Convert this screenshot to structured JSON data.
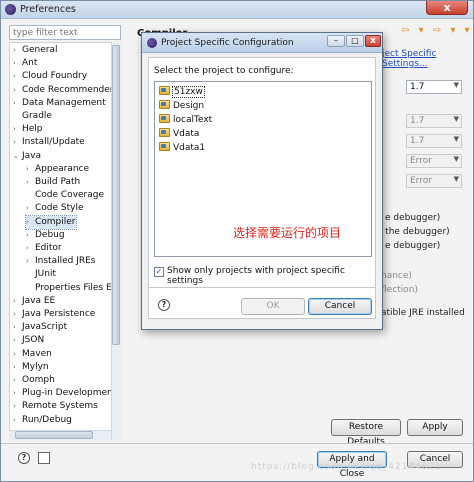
{
  "window": {
    "title": "Preferences",
    "close_glyph": "x"
  },
  "filter": {
    "placeholder": "type filter text"
  },
  "tree": {
    "items": [
      {
        "label": "General",
        "depth": 0,
        "expander": "›"
      },
      {
        "label": "Ant",
        "depth": 0,
        "expander": "›"
      },
      {
        "label": "Cloud Foundry",
        "depth": 0,
        "expander": "›"
      },
      {
        "label": "Code Recommenders",
        "depth": 0,
        "expander": "›"
      },
      {
        "label": "Data Management",
        "depth": 0,
        "expander": "›"
      },
      {
        "label": "Gradle",
        "depth": 0,
        "expander": ""
      },
      {
        "label": "Help",
        "depth": 0,
        "expander": "›"
      },
      {
        "label": "Install/Update",
        "depth": 0,
        "expander": "›"
      },
      {
        "label": "Java",
        "depth": 0,
        "expander": "⌄"
      },
      {
        "label": "Appearance",
        "depth": 1,
        "expander": "›"
      },
      {
        "label": "Build Path",
        "depth": 1,
        "expander": "›"
      },
      {
        "label": "Code Coverage",
        "depth": 1,
        "expander": ""
      },
      {
        "label": "Code Style",
        "depth": 1,
        "expander": "›"
      },
      {
        "label": "Compiler",
        "depth": 1,
        "expander": "›",
        "selected": true
      },
      {
        "label": "Debug",
        "depth": 1,
        "expander": "›"
      },
      {
        "label": "Editor",
        "depth": 1,
        "expander": "›"
      },
      {
        "label": "Installed JREs",
        "depth": 1,
        "expander": "›"
      },
      {
        "label": "JUnit",
        "depth": 1,
        "expander": ""
      },
      {
        "label": "Properties Files Ec",
        "depth": 1,
        "expander": ""
      },
      {
        "label": "Java EE",
        "depth": 0,
        "expander": "›"
      },
      {
        "label": "Java Persistence",
        "depth": 0,
        "expander": "›"
      },
      {
        "label": "JavaScript",
        "depth": 0,
        "expander": "›"
      },
      {
        "label": "JSON",
        "depth": 0,
        "expander": "›"
      },
      {
        "label": "Maven",
        "depth": 0,
        "expander": "›"
      },
      {
        "label": "Mylyn",
        "depth": 0,
        "expander": "›"
      },
      {
        "label": "Oomph",
        "depth": 0,
        "expander": "›"
      },
      {
        "label": "Plug-in Development",
        "depth": 0,
        "expander": "›"
      },
      {
        "label": "Remote Systems",
        "depth": 0,
        "expander": "›"
      },
      {
        "label": "Run/Debug",
        "depth": 0,
        "expander": "›"
      }
    ]
  },
  "page": {
    "title": "Compiler",
    "nav_glyphs": "⇦ ▾ ⇨ ▾ ▾",
    "configure_link": "ject Specific Settings...",
    "combos": [
      {
        "value": "1.7",
        "enabled": true
      },
      {
        "value": "1.7",
        "enabled": false
      },
      {
        "value": "1.7",
        "enabled": false
      },
      {
        "value": "Error",
        "enabled": false
      },
      {
        "value": "Error",
        "enabled": false
      }
    ],
    "partial_texts": [
      {
        "text": "e debugger)",
        "dim": false
      },
      {
        "text": "y the debugger)",
        "dim": false
      },
      {
        "text": "e debugger)",
        "dim": false
      },
      {
        "text": "nance)",
        "dim": true
      },
      {
        "text": "flection)",
        "dim": true
      },
      {
        "text": "atible JRE installed",
        "dim": false
      }
    ],
    "restore_defaults": "Restore Defaults",
    "apply": "Apply",
    "apply_and_close": "Apply and Close",
    "cancel": "Cancel"
  },
  "dialog": {
    "title": "Project Specific Configuration",
    "min_glyph": "–",
    "max_glyph": "□",
    "close_glyph": "x",
    "prompt": "Select the project to configure:",
    "projects": [
      "51zxw",
      "Design",
      "localText",
      "Vdata",
      "Vdata1"
    ],
    "annotation": "选择需要运行的项目",
    "only_projects_label": "Show only projects with project specific settings",
    "only_projects_checked": true,
    "ok": "OK",
    "cancel": "Cancel"
  },
  "help_glyph": "?",
  "check_glyph": "✓",
  "watermark": "https://blog.csdn.net/qq_42144621"
}
